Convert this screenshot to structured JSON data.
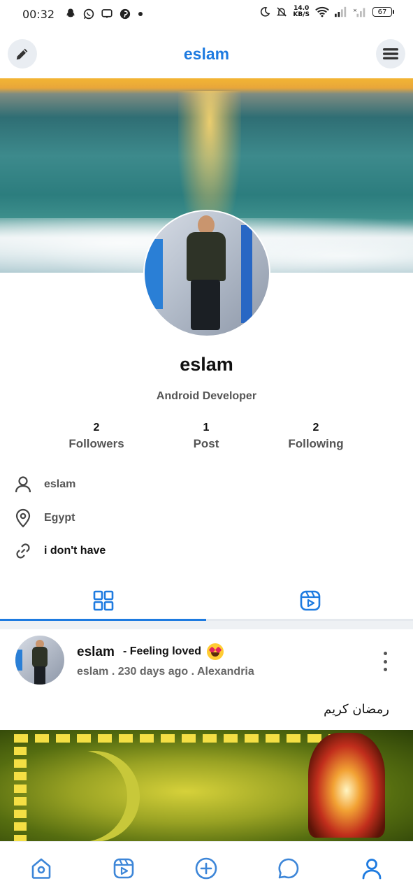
{
  "status_bar": {
    "time": "00:32",
    "net_speed": "14.0",
    "net_unit": "KB/S",
    "battery": "67",
    "left_icons": [
      "snapchat-icon",
      "whatsapp-icon",
      "message-icon",
      "pinterest-icon",
      "dot-icon"
    ],
    "right_icons": [
      "moon-icon",
      "bell-off-icon",
      "wifi-icon",
      "signal-icon",
      "signal-x-icon",
      "battery-icon"
    ]
  },
  "app_bar": {
    "title": "eslam",
    "left_icon": "edit-pencil-icon",
    "right_icon": "menu-icon"
  },
  "profile": {
    "name": "eslam",
    "bio": "Android Developer",
    "stats": [
      {
        "value": "2",
        "label": "Followers"
      },
      {
        "value": "1",
        "label": "Post"
      },
      {
        "value": "2",
        "label": "Following"
      }
    ],
    "info": {
      "username": "eslam",
      "location": "Egypt",
      "link": "i don't have"
    }
  },
  "tabs": [
    {
      "name": "grid",
      "icon": "grid-icon",
      "selected": true
    },
    {
      "name": "reels",
      "icon": "reels-icon",
      "selected": false
    }
  ],
  "post": {
    "author": "eslam",
    "feeling": "- Feeling loved",
    "meta": "eslam  .  230 days ago . Alexandria",
    "text": "رمضان كريم"
  },
  "bottom_nav": [
    {
      "icon": "home-icon"
    },
    {
      "icon": "reels-icon"
    },
    {
      "icon": "add-circle-icon"
    },
    {
      "icon": "chat-icon"
    },
    {
      "icon": "profile-icon",
      "active": true
    }
  ],
  "colors": {
    "accent": "#1e7be0",
    "text_dark": "#111111",
    "text_muted": "#555555",
    "nav_icon": "#3d86d8"
  }
}
